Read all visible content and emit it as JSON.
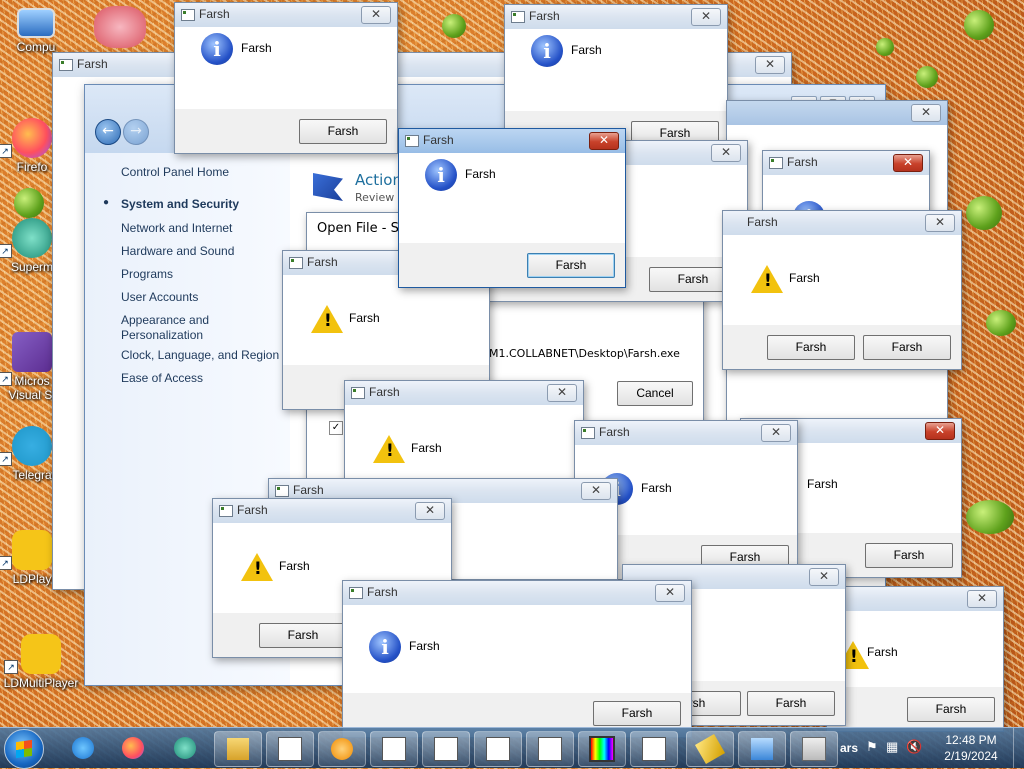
{
  "desktop": {
    "icons": [
      {
        "label": "Compu"
      },
      {
        "label": "Firefo"
      },
      {
        "label": "Superm"
      },
      {
        "label": "Micros Visual St"
      },
      {
        "label": "Telegra"
      },
      {
        "label": "LDPlay"
      },
      {
        "label": "LDMultiPlayer"
      }
    ]
  },
  "control_panel": {
    "home": "Control Panel Home",
    "items": [
      "System and Security",
      "Network and Internet",
      "Hardware and Sound",
      "Programs",
      "User Accounts",
      "Appearance and",
      "Personalization",
      "Clock, Language, and Region",
      "Ease of Access"
    ],
    "action_title": "Action",
    "action_sub": "Review y"
  },
  "open_file": {
    "title": "Open File - Sec",
    "path": "M1.COLLABNET\\Desktop\\Farsh.exe",
    "path_prefix": "h",
    "cancel": "Cancel"
  },
  "dialogs": {
    "title": "Farsh",
    "message": "Farsh",
    "button": "Farsh",
    "partial_button": "rsh",
    "close_glyph": "✕"
  },
  "taskbar": {
    "time": "12:48 PM",
    "date": "2/19/2024",
    "lang": "ars"
  }
}
